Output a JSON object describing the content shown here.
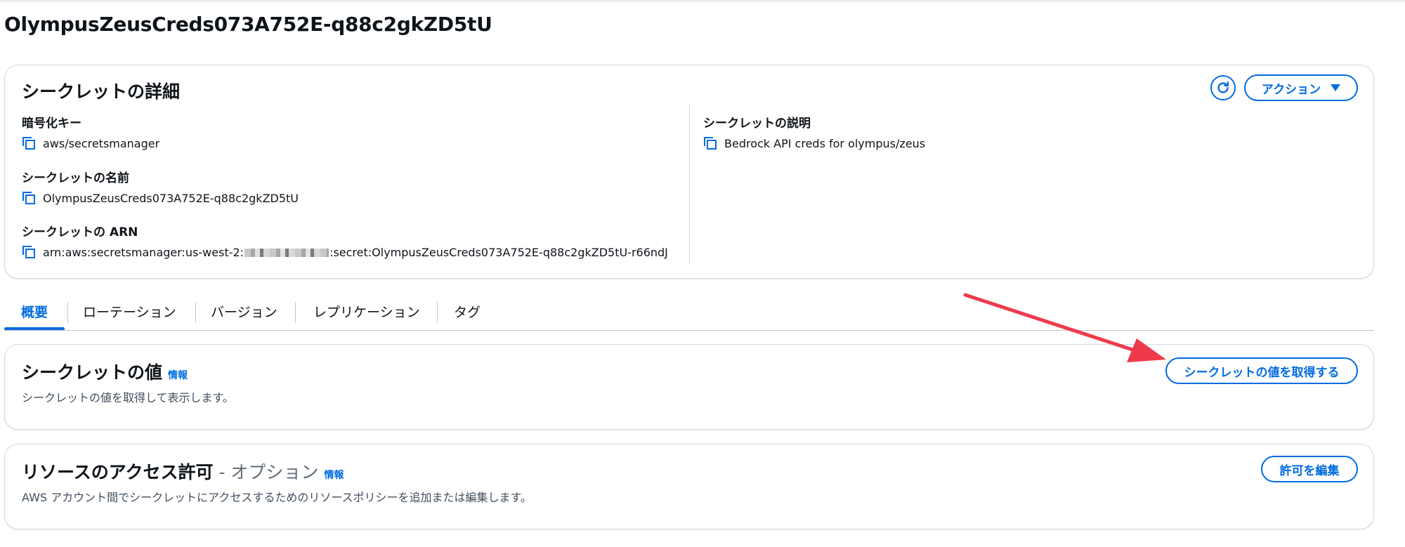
{
  "page": {
    "title": "OlympusZeusCreds073A752E-q88c2gkZD5tU"
  },
  "details": {
    "heading": "シークレットの詳細",
    "action_label": "アクション",
    "encryption_key": {
      "label": "暗号化キー",
      "value": "aws/secretsmanager"
    },
    "secret_name": {
      "label": "シークレットの名前",
      "value": "OlympusZeusCreds073A752E-q88c2gkZD5tU"
    },
    "secret_arn": {
      "label": "シークレットの ARN",
      "value_prefix": "arn:aws:secretsmanager:us-west-2:",
      "value_suffix": ":secret:OlympusZeusCreds073A752E-q88c2gkZD5tU-r66ndJ"
    },
    "description": {
      "label": "シークレットの説明",
      "value": "Bedrock API creds for olympus/zeus"
    }
  },
  "tabs": [
    {
      "label": "概要",
      "active": true
    },
    {
      "label": "ローテーション",
      "active": false
    },
    {
      "label": "バージョン",
      "active": false
    },
    {
      "label": "レプリケーション",
      "active": false
    },
    {
      "label": "タグ",
      "active": false
    }
  ],
  "secret_value": {
    "heading": "シークレットの値",
    "info": "情報",
    "description": "シークレットの値を取得して表示します。",
    "retrieve_label": "シークレットの値を取得する"
  },
  "resource_permissions": {
    "heading": "リソースのアクセス許可",
    "heading_optional": " - オプション",
    "info": "情報",
    "description": "AWS アカウント間でシークレットにアクセスするためのリソースポリシーを追加または編集します。",
    "edit_label": "許可を編集"
  },
  "colors": {
    "accent": "#006ce0",
    "annotation_arrow": "#ee3a4b",
    "border": "#d5dbdb"
  },
  "icons": [
    "copy-icon",
    "refresh-icon",
    "caret-down-icon",
    "annotation-arrow"
  ]
}
